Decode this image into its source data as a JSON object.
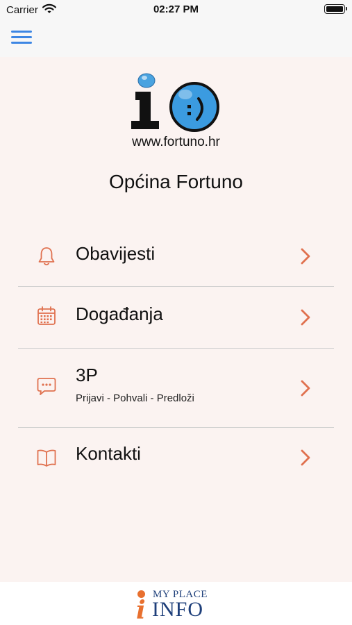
{
  "status_bar": {
    "carrier": "Carrier",
    "time": "02:27 PM"
  },
  "nav": {
    "menu_icon": "hamburger-icon"
  },
  "header": {
    "logo_icon": "fortuno-logo",
    "site_url": "www.fortuno.hr",
    "title": "Općina Fortuno"
  },
  "menu": {
    "items": [
      {
        "label": "Obavijesti",
        "icon": "bell-icon"
      },
      {
        "label": "Događanja",
        "icon": "calendar-icon"
      },
      {
        "label": "3P",
        "subtitle": "Prijavi - Pohvali - Predloži",
        "icon": "chat-bubble-icon"
      },
      {
        "label": "Kontakti",
        "icon": "book-icon"
      }
    ]
  },
  "footer": {
    "brand_top": "MY PLACE",
    "brand_bottom": "INFO",
    "brand_i": "i"
  },
  "colors": {
    "accent": "#e0714f",
    "nav_icon": "#3d86e3",
    "background": "#fbf3f1",
    "brand_navy": "#1e3f7a",
    "brand_orange": "#e8702f"
  }
}
